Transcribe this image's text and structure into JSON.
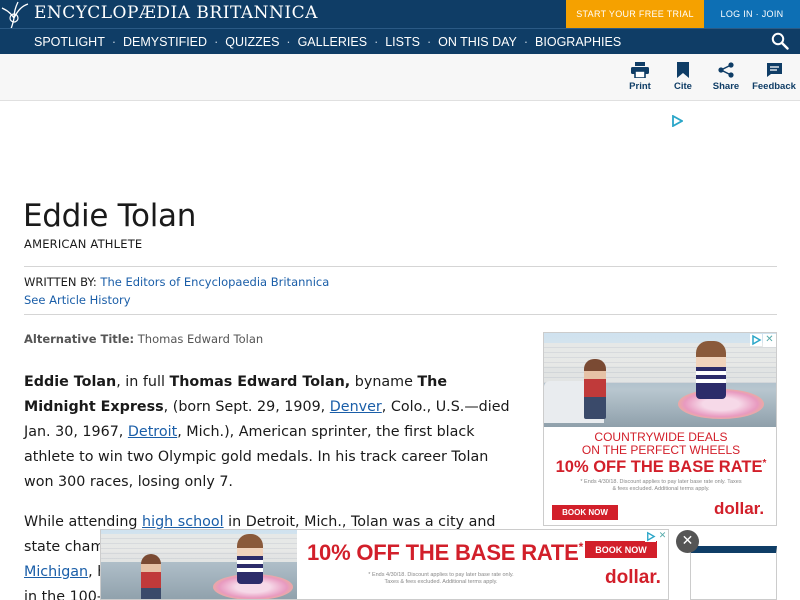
{
  "header": {
    "logo_text": "ENCYCLOPÆDIA BRITANNICA",
    "trial_label": "START YOUR FREE TRIAL",
    "login_label": "LOG IN · JOIN",
    "nav": [
      "SPOTLIGHT",
      "DEMYSTIFIED",
      "QUIZZES",
      "GALLERIES",
      "LISTS",
      "ON THIS DAY",
      "BIOGRAPHIES"
    ],
    "nav_separator": "·"
  },
  "toolbar": {
    "print": "Print",
    "cite": "Cite",
    "share": "Share",
    "feedback": "Feedback"
  },
  "article": {
    "title": "Eddie Tolan",
    "subtitle": "AMERICAN ATHLETE",
    "written_by_label": "WRITTEN BY:",
    "author": "The Editors of Encyclopaedia Britannica",
    "history_link": "See Article History",
    "alt_title_label": "Alternative Title:",
    "alt_title": "Thomas Edward Tolan",
    "p1": {
      "name": "Eddie Tolan",
      "t1": ", in full ",
      "full_name": "Thomas Edward Tolan,",
      "t2": " byname ",
      "byname": "The Midnight Express",
      "t3": ", (born Sept. 29, 1909, ",
      "link1": "Denver",
      "t4": ", Colo., U.S.—died Jan. 30, 1967, ",
      "link2": "Detroit",
      "t5": ", Mich.), American sprinter, the first black athlete to win two Olympic gold medals. In his track career Tolan won 300 races, losing only 7."
    },
    "p2": {
      "t1": "While attending ",
      "link1": "high school",
      "t2": " in Detroit, Mich., Tolan was a city and state cham",
      "link2": "Michigan",
      "t3": ", h",
      "t4": "in the 100-"
    }
  },
  "ads": {
    "side": {
      "line1": "COUNTRYWIDE DEALS",
      "line2": "ON THE PERFECT WHEELS",
      "headline": "10% OFF THE BASE RATE",
      "headline_mark": "*",
      "fine1": "* Ends 4/30/18. Discount applies to pay later base rate only. Taxes",
      "fine2": "& fees excluded. Additional terms apply.",
      "book": "BOOK NOW",
      "logo": "dollar."
    },
    "bottom": {
      "headline": "10% OFF THE BASE RATE",
      "headline_mark": "*",
      "fine1": "* Ends 4/30/18. Discount applies to pay later base rate only.",
      "fine2": "Taxes & fees excluded. Additional terms apply.",
      "book": "BOOK NOW",
      "logo": "dollar."
    },
    "close_glyph": "✕",
    "small_close": "✕"
  },
  "colors": {
    "header_bg": "#0f3d66",
    "trial_bg": "#f5a100",
    "login_bg": "#0d6fb4",
    "link": "#1a5ea8",
    "ad_red": "#d21f2a"
  },
  "icons": [
    "thistle-logo-icon",
    "search-icon",
    "print-icon",
    "bookmark-icon",
    "share-icon",
    "feedback-icon",
    "ad-choices-icon"
  ]
}
